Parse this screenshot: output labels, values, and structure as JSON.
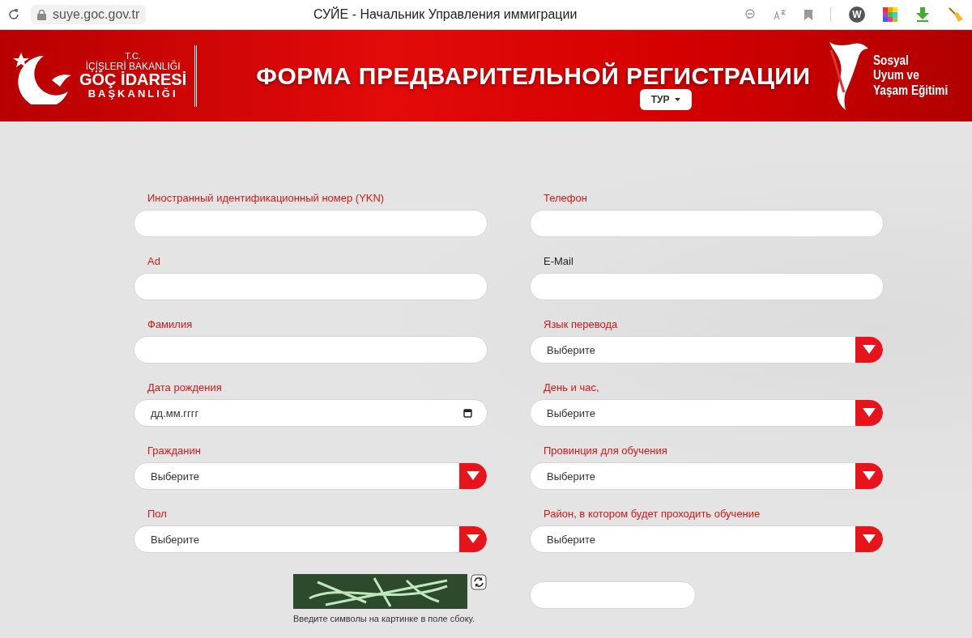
{
  "browser": {
    "url": "suye.goc.gov.tr",
    "title": "СУЙЕ - Начальник Управления иммиграции",
    "extension_letter": "W"
  },
  "header": {
    "logo_lines": [
      "T.C.",
      "İÇİŞLERİ BAKANLIĞI",
      "GÖÇ İDARESİ",
      "BAŞKANLIĞI"
    ],
    "title": "ФОРМА ПРЕДВАРИТЕЛЬНОЙ РЕГИСТРАЦИИ",
    "language": "ТУР",
    "right_logo_lines": [
      "Sosyal",
      "Uyum ve",
      "Yaşam Eğitimi"
    ]
  },
  "form": {
    "left": [
      {
        "kind": "text",
        "label": "Иностранный идентификационный номер (YKN)",
        "required": true
      },
      {
        "kind": "text",
        "label": "Ad",
        "required": true
      },
      {
        "kind": "text",
        "label": "Фамилия",
        "required": true
      },
      {
        "kind": "date",
        "label": "Дата рождения",
        "required": true,
        "placeholder": "дд.мм.гггг"
      },
      {
        "kind": "select",
        "label": "Гражданин",
        "required": true,
        "value": "Выберите"
      },
      {
        "kind": "select",
        "label": "Пол",
        "required": true,
        "value": "Выберите"
      }
    ],
    "right": [
      {
        "kind": "text",
        "label": "Телефон",
        "required": true
      },
      {
        "kind": "text",
        "label": "E-Mail",
        "required": false
      },
      {
        "kind": "select",
        "label": "Язык перевода",
        "required": true,
        "value": "Выберите"
      },
      {
        "kind": "select",
        "label": "День и час,",
        "required": true,
        "value": "Выберите"
      },
      {
        "kind": "select",
        "label": "Провинция для обучения",
        "required": true,
        "value": "Выберите"
      },
      {
        "kind": "select",
        "label": "Район, в котором будет проходить обучение",
        "required": true,
        "value": "Выберите"
      }
    ]
  },
  "captcha": {
    "hint": "Введите символы на картинке в поле сбоку."
  }
}
